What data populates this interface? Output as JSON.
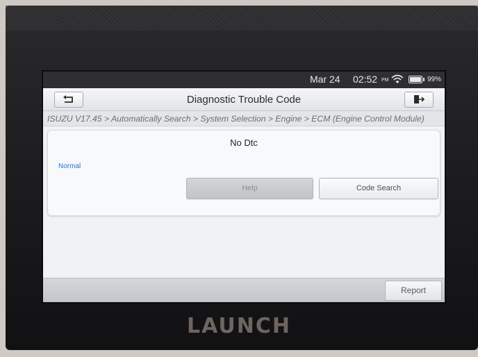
{
  "status_bar": {
    "date": "Mar 24",
    "time": "02:52",
    "ampm": "PM",
    "battery": "99%"
  },
  "header": {
    "title": "Diagnostic Trouble Code"
  },
  "breadcrumb": "ISUZU V17.45 > Automatically Search > System Selection > Engine > ECM (Engine Control Module)",
  "result": {
    "title": "No Dtc",
    "status": "Normal",
    "help_label": "Help",
    "code_search_label": "Code Search"
  },
  "footer": {
    "report_label": "Report"
  },
  "device": {
    "brand": "LAUNCH"
  },
  "colors": {
    "status_text": "#2b6fd8",
    "statusbar_bg": "#2d2f33"
  },
  "icons": {
    "back": "back-arrow-icon",
    "exit": "exit-icon",
    "wifi": "wifi-icon",
    "battery": "battery-icon"
  }
}
